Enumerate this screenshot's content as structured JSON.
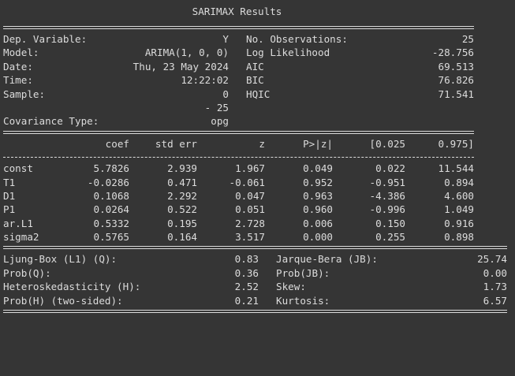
{
  "title": "SARIMAX Results",
  "info_left": [
    {
      "label": "Dep. Variable:",
      "value": "Y"
    },
    {
      "label": "Model:",
      "value": "ARIMA(1, 0, 0)"
    },
    {
      "label": "Date:",
      "value": "Thu, 23 May 2024"
    },
    {
      "label": "Time:",
      "value": "12:22:02"
    },
    {
      "label": "Sample:",
      "value": "0"
    },
    {
      "label": "",
      "value": "- 25"
    },
    {
      "label": "Covariance Type:",
      "value": "opg"
    }
  ],
  "info_right": [
    {
      "label": "No. Observations:",
      "value": "25"
    },
    {
      "label": "Log Likelihood",
      "value": "-28.756"
    },
    {
      "label": "AIC",
      "value": "69.513"
    },
    {
      "label": "BIC",
      "value": "76.826"
    },
    {
      "label": "HQIC",
      "value": "71.541"
    }
  ],
  "coef_table": {
    "columns": [
      "coef",
      "std err",
      "z",
      "P>|z|",
      "[0.025",
      "0.975]"
    ],
    "rows": [
      {
        "name": "const",
        "cells": [
          "5.7826",
          "2.939",
          "1.967",
          "0.049",
          "0.022",
          "11.544"
        ]
      },
      {
        "name": "T1",
        "cells": [
          "-0.0286",
          "0.471",
          "-0.061",
          "0.952",
          "-0.951",
          "0.894"
        ]
      },
      {
        "name": "D1",
        "cells": [
          "0.1068",
          "2.292",
          "0.047",
          "0.963",
          "-4.386",
          "4.600"
        ]
      },
      {
        "name": "P1",
        "cells": [
          "0.0264",
          "0.522",
          "0.051",
          "0.960",
          "-0.996",
          "1.049"
        ]
      },
      {
        "name": "ar.L1",
        "cells": [
          "0.5332",
          "0.195",
          "2.728",
          "0.006",
          "0.150",
          "0.916"
        ]
      },
      {
        "name": "sigma2",
        "cells": [
          "0.5765",
          "0.164",
          "3.517",
          "0.000",
          "0.255",
          "0.898"
        ]
      }
    ]
  },
  "diagnostics": [
    {
      "left_label": "Ljung-Box (L1) (Q):",
      "left_value": "0.83",
      "right_label": "Jarque-Bera (JB):",
      "right_value": "25.74"
    },
    {
      "left_label": "Prob(Q):",
      "left_value": "0.36",
      "right_label": "Prob(JB):",
      "right_value": "0.00"
    },
    {
      "left_label": "Heteroskedasticity (H):",
      "left_value": "2.52",
      "right_label": "Skew:",
      "right_value": "1.73"
    },
    {
      "left_label": "Prob(H) (two-sided):",
      "left_value": "0.21",
      "right_label": "Kurtosis:",
      "right_value": "6.57"
    }
  ]
}
